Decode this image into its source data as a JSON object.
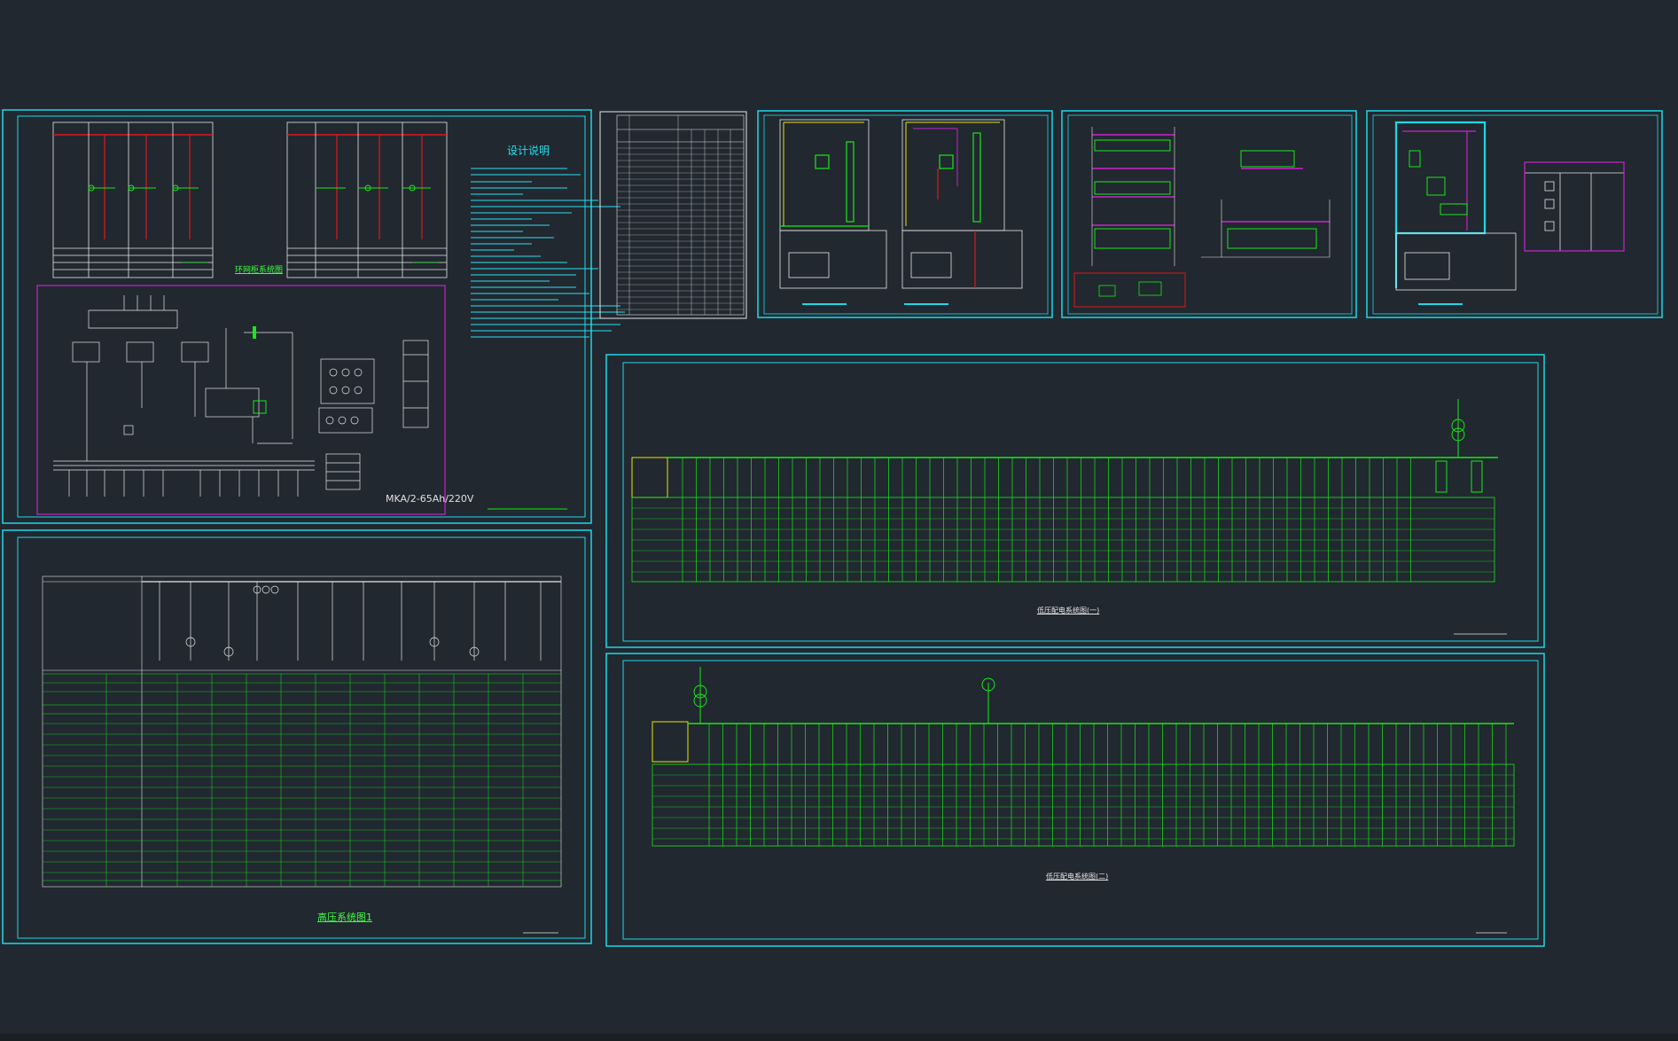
{
  "canvas": {
    "background": "#212830"
  },
  "colors": {
    "frame": "#1ed7e6",
    "green": "#18e818",
    "red": "#e01818",
    "magenta": "#cc22cc",
    "white": "#e6e6e6",
    "cyan_text": "#2ae0f0",
    "gray": "#9aa0a6",
    "yellow": "#e6e600"
  },
  "sheet1": {
    "title_design_notes": "设计说明",
    "title_ring_network": "环网柜系统图",
    "battery_model": "MKA/2-65Ah/220V"
  },
  "sheet2": {
    "title": "高压系统图1"
  },
  "sheet3": {
    "title": "低压配电系统图(一)"
  },
  "sheet4": {
    "title": "低压配电系统图(二)"
  }
}
